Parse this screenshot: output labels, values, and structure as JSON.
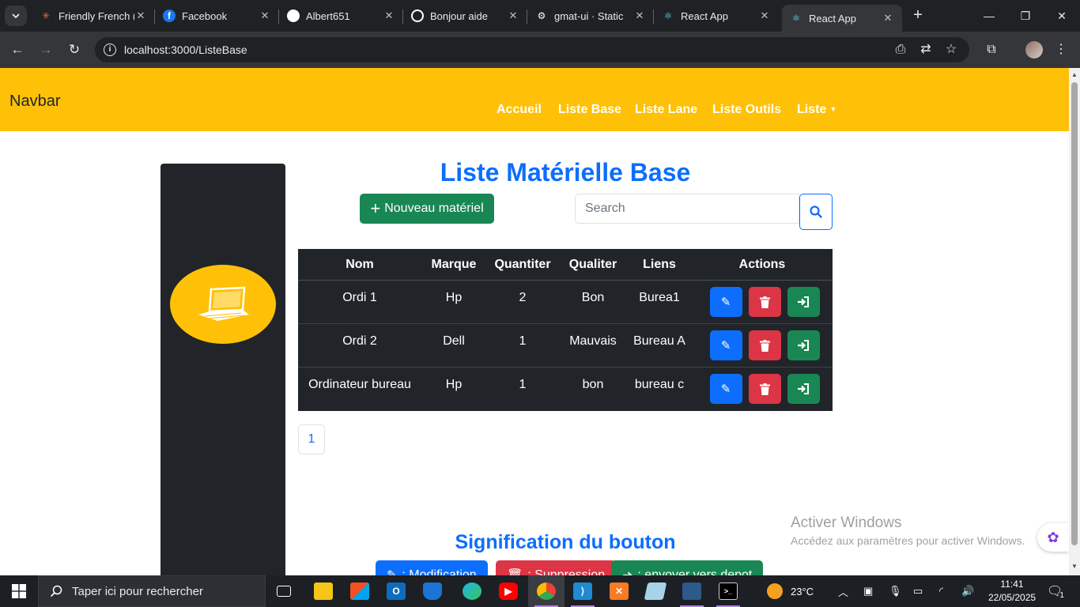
{
  "browser": {
    "tabs": [
      {
        "title": "Friendly French (",
        "favicon": "sparkle-icon",
        "color": "#e8764a"
      },
      {
        "title": "Facebook",
        "favicon": "facebook-icon",
        "color": "#1877f2"
      },
      {
        "title": "Albert651",
        "favicon": "github-icon",
        "color": "#ffffff"
      },
      {
        "title": "Bonjour aide",
        "favicon": "openai-icon",
        "color": "#ffffff"
      },
      {
        "title": "gmat-ui · Static",
        "favicon": "netlify-icon",
        "color": "#ffffff"
      },
      {
        "title": "React App",
        "favicon": "react-icon",
        "color": "#61dafb"
      },
      {
        "title": "React App",
        "favicon": "react-icon",
        "color": "#61dafb"
      }
    ],
    "url": "localhost:3000/ListeBase"
  },
  "navbar": {
    "brand": "Navbar",
    "links": [
      "Accueil",
      "Liste Base",
      "Liste Lane",
      "Liste Outils",
      "Liste"
    ]
  },
  "main": {
    "title": "Liste Matérielle Base",
    "new_button": "Nouveau matériel",
    "search_placeholder": "Search",
    "table": {
      "headers": [
        "Nom",
        "Marque",
        "Quantiter",
        "Qualiter",
        "Liens",
        "Actions"
      ],
      "rows": [
        {
          "nom": "Ordi 1",
          "marque": "Hp",
          "quantiter": "2",
          "qualiter": "Bon",
          "liens": "Burea1"
        },
        {
          "nom": "Ordi 2",
          "marque": "Dell",
          "quantiter": "1",
          "qualiter": "Mauvais",
          "liens": "Bureau A"
        },
        {
          "nom": "Ordinateur bureau",
          "marque": "Hp",
          "quantiter": "1",
          "qualiter": "bon",
          "liens": "bureau c"
        }
      ]
    },
    "pagination": [
      "1"
    ],
    "legend": {
      "title": "Signification du bouton",
      "buttons": [
        ": Modification",
        ": Suppression",
        ": envoyer vers depot"
      ]
    }
  },
  "watermark": {
    "line1": "Activer Windows",
    "line2": "Accédez aux paramètres pour activer Windows."
  },
  "taskbar": {
    "search_placeholder": "Taper ici pour rechercher",
    "weather": "23°C",
    "time": "11:41",
    "date": "22/05/2025",
    "notifications": "1"
  },
  "colors": {
    "primary": "#0d6efd",
    "success": "#198754",
    "danger": "#dc3545",
    "warning": "#ffc107",
    "dark": "#212529"
  }
}
